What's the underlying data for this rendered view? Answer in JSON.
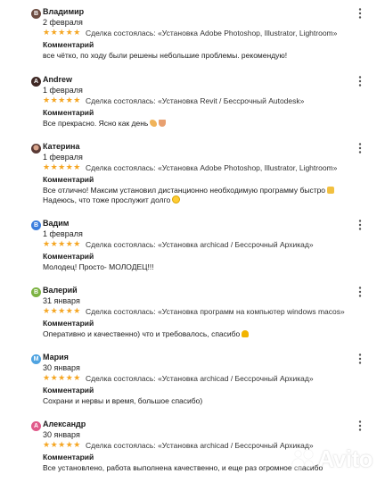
{
  "comment_label": "Комментарий",
  "deal_prefix": "Сделка состоялась:",
  "stars_text": "★★★★★",
  "watermark_text": "Avito",
  "colors": {
    "star": "#f5a623",
    "avatar_v": "#6d4c41",
    "avatar_blue": "#3b7ddd",
    "avatar_green": "#7cb342",
    "avatar_cyan": "#4fa3e0",
    "avatar_pink": "#e05a8a"
  },
  "reviews": [
    {
      "initial": "В",
      "avatar_color": "#6d4c41",
      "name": "Владимир",
      "date": "2 февраля",
      "deal": "«Установка Adobe Photoshop, Illustrator, Lightroom»",
      "comment": "все чётко, по ходу были решены небольшие проблемы. рекомендую!",
      "emoji": ""
    },
    {
      "initial": "A",
      "avatar_color": "#3e2723",
      "name": "Andrew",
      "date": "1 февраля",
      "deal": "«Установка Revit / Бессрочный Autodesk»",
      "comment": "Все прекрасно. Ясно как день",
      "emoji": "muscle-pray"
    },
    {
      "initial": "К",
      "avatar_color": "#8d5a4a",
      "name": "Катерина",
      "date": "1 февраля",
      "deal": "«Установка Adobe Photoshop, Illustrator, Lightroom»",
      "comment": "Все отлично! Максим установил дистанционно необходимую программу быстро",
      "comment_cont": " Надеюсь, что тоже прослужит долго",
      "emoji": "scream-face"
    },
    {
      "initial": "В",
      "avatar_color": "#3b7ddd",
      "name": "Вадим",
      "date": "1 февраля",
      "deal": "«Установка archicad / Бессрочный Архикад»",
      "comment": "Молодец! Просто- МОЛОДЕЦ!!!",
      "emoji": ""
    },
    {
      "initial": "В",
      "avatar_color": "#7cb342",
      "name": "Валерий",
      "date": "31 января",
      "deal": "«Установка программ на компьютер windows macos»",
      "comment": "Оперативно и качественно) что и требовалось, спасибо",
      "emoji": "heart"
    },
    {
      "initial": "М",
      "avatar_color": "#4fa3e0",
      "name": "Мария",
      "date": "30 января",
      "deal": "«Установка archicad / Бессрочный Архикад»",
      "comment": "Сохрани и нервы и время, большое спасибо)",
      "emoji": ""
    },
    {
      "initial": "А",
      "avatar_color": "#e05a8a",
      "name": "Александр",
      "date": "30 января",
      "deal": "«Установка archicad / Бессрочный Архикад»",
      "comment": "Все установлено, работа выполнена качественно, и еще раз огромное спасибо",
      "emoji": ""
    }
  ]
}
